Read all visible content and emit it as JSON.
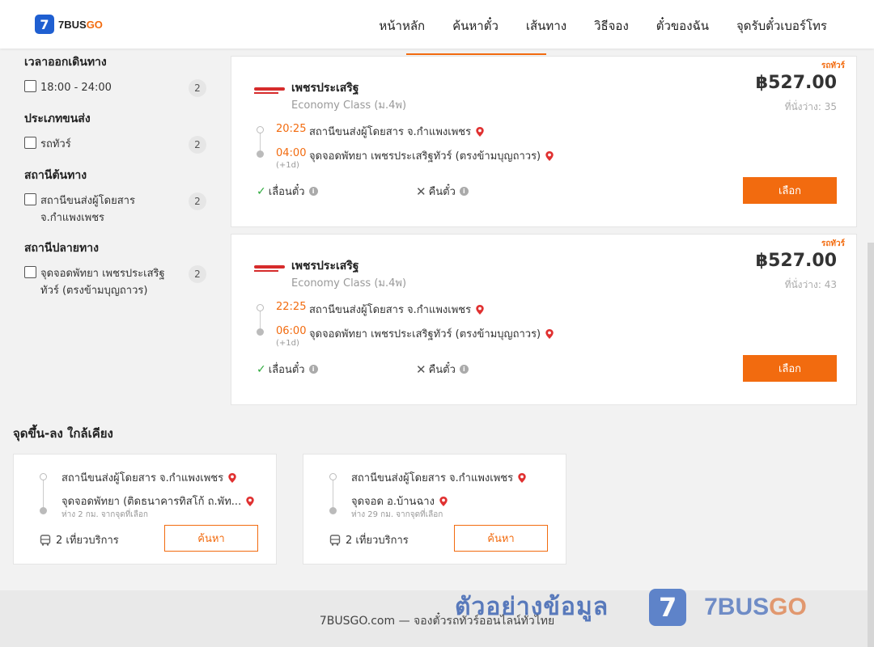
{
  "header": {
    "logo_mark": "7",
    "logo_a": "7BUS",
    "logo_b": "GO",
    "nav": [
      "หน้าหลัก",
      "ค้นหาตั๋ว",
      "เส้นทาง",
      "วิธีจอง",
      "ตั๋วของฉัน",
      "จุดรับตั๋วเบอร์โทร"
    ]
  },
  "filters": [
    {
      "title": "เวลาออกเดินทาง",
      "options": [
        {
          "label": "18:00 - 24:00",
          "count": "2"
        }
      ]
    },
    {
      "title": "ประเภทขนส่ง",
      "options": [
        {
          "label": "รถทัวร์",
          "count": "2"
        }
      ]
    },
    {
      "title": "สถานีต้นทาง",
      "options": [
        {
          "label": "สถานีขนส่งผู้โดยสาร จ.กำแพงเพชร",
          "count": "2"
        }
      ]
    },
    {
      "title": "สถานีปลายทาง",
      "options": [
        {
          "label": "จุดจอดพัทยา เพชรประเสริฐทัวร์ (ตรงข้ามบุญถาวร)",
          "count": "2"
        }
      ]
    }
  ],
  "trips": [
    {
      "tag": "รถทัวร์",
      "operator": "เพชรประเสริฐ",
      "class": "Economy Class (ม.4พ)",
      "price": "฿527.00",
      "seats": "ที่นั่งว่าง: 35",
      "depart_time": "20:25",
      "depart_stop": "สถานีขนส่งผู้โดยสาร จ.กำแพงเพชร",
      "arrive_time": "04:00",
      "arrive_stop": "จุดจอดพัทยา เพชรประเสริฐทัวร์ (ตรงข้ามบุญถาวร)",
      "next_day": "(+1d)",
      "reschedule": "เลื่อนตั๋ว",
      "refund": "คืนตั๋ว",
      "select": "เลือก"
    },
    {
      "tag": "รถทัวร์",
      "operator": "เพชรประเสริฐ",
      "class": "Economy Class (ม.4พ)",
      "price": "฿527.00",
      "seats": "ที่นั่งว่าง: 43",
      "depart_time": "22:25",
      "depart_stop": "สถานีขนส่งผู้โดยสาร จ.กำแพงเพชร",
      "arrive_time": "06:00",
      "arrive_stop": "จุดจอดพัทยา เพชรประเสริฐทัวร์ (ตรงข้ามบุญถาวร)",
      "next_day": "(+1d)",
      "reschedule": "เลื่อนตั๋ว",
      "refund": "คืนตั๋ว",
      "select": "เลือก"
    }
  ],
  "nearby": {
    "title": "จุดขึ้น-ลง ใกล้เคียง",
    "items": [
      {
        "from": "สถานีขนส่งผู้โดยสาร จ.กำแพงเพชร",
        "to": "จุดจอดพัทยา (ติดธนาคารทิสโก้ ถ.พัท...",
        "distance": "ห่าง 2 กม. จากจุดที่เลือก",
        "trips": "2 เที่ยวบริการ",
        "button": "ค้นหา"
      },
      {
        "from": "สถานีขนส่งผู้โดยสาร จ.กำแพงเพชร",
        "to": "จุดจอด อ.บ้านฉาง",
        "distance": "ห่าง 29 กม. จากจุดที่เลือก",
        "trips": "2 เที่ยวบริการ",
        "button": "ค้นหา"
      }
    ]
  },
  "footer": {
    "text": "7BUSGO.com — จองตั๋วรถทัวร์ออนไลน์ทั่วไทย",
    "watermark": "ตัวอย่างข้อมูล",
    "wm_mark": "7",
    "wm_a": "7BUS",
    "wm_b": "GO"
  }
}
